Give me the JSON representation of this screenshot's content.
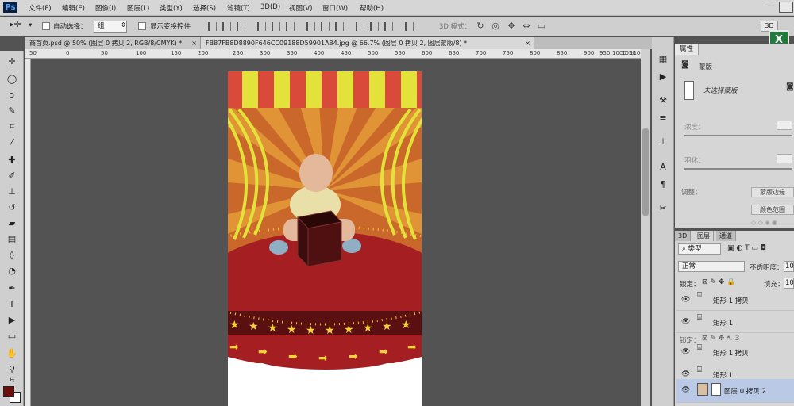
{
  "app": {
    "logo": "Ps"
  },
  "menu": [
    "文件(F)",
    "编辑(E)",
    "图像(I)",
    "图层(L)",
    "类型(Y)",
    "选择(S)",
    "滤镜(T)",
    "3D(D)",
    "视图(V)",
    "窗口(W)",
    "帮助(H)"
  ],
  "window": {
    "minimize": "—"
  },
  "options": {
    "auto_select_label": "自动选择：",
    "auto_select_value": "组",
    "show_transform_label": "显示变换控件",
    "mode_3d_label": "3D 模式：",
    "mode_3d_button": "3D"
  },
  "tabs": [
    {
      "label": "商首页.psd @ 50% (图层 0 拷贝 2, RGB/8/CMYK) *",
      "close": "×"
    },
    {
      "label": "FB87FB8D8890F646CC09188D59901A84.jpg @ 66.7% (图层 0 拷贝 2, 图层蒙版/8) *",
      "close": "×"
    }
  ],
  "ruler_ticks": [
    "50",
    "0",
    "50",
    "100",
    "150",
    "200",
    "250",
    "300",
    "350",
    "400",
    "450",
    "500",
    "550",
    "600",
    "650",
    "700",
    "750",
    "800",
    "850",
    "900",
    "950",
    "1000",
    "1050",
    "1100",
    "1150",
    "1200",
    "1250",
    "1300"
  ],
  "properties": {
    "tab": "属性",
    "title": "蒙版",
    "no_mask": "未选择蒙版",
    "density": "浓度：",
    "feather": "羽化：",
    "adjust": "调整：",
    "mask_edge": "蒙版边缘",
    "color_range": "颜色范围"
  },
  "layers_panel": {
    "tabs": [
      "3D",
      "图层",
      "通道"
    ],
    "filter": "类型",
    "blend_mode": "正常",
    "opacity_label": "不透明度：",
    "opacity_value": "10",
    "lock_label": "锁定：",
    "fill_label": "填充：",
    "fill_value": "10",
    "ghost_lock": "锁定：",
    "layers": [
      {
        "name": "矩形 1 拷贝"
      },
      {
        "name": "矩形 1"
      },
      {
        "name": "矩形 1 拷贝"
      },
      {
        "name": "矩形 1"
      },
      {
        "name": "图层 0 拷贝 2"
      }
    ]
  },
  "colors": {
    "foreground": "#6b0e0e",
    "background": "#ffffff",
    "accent": "#0b1f3a"
  }
}
